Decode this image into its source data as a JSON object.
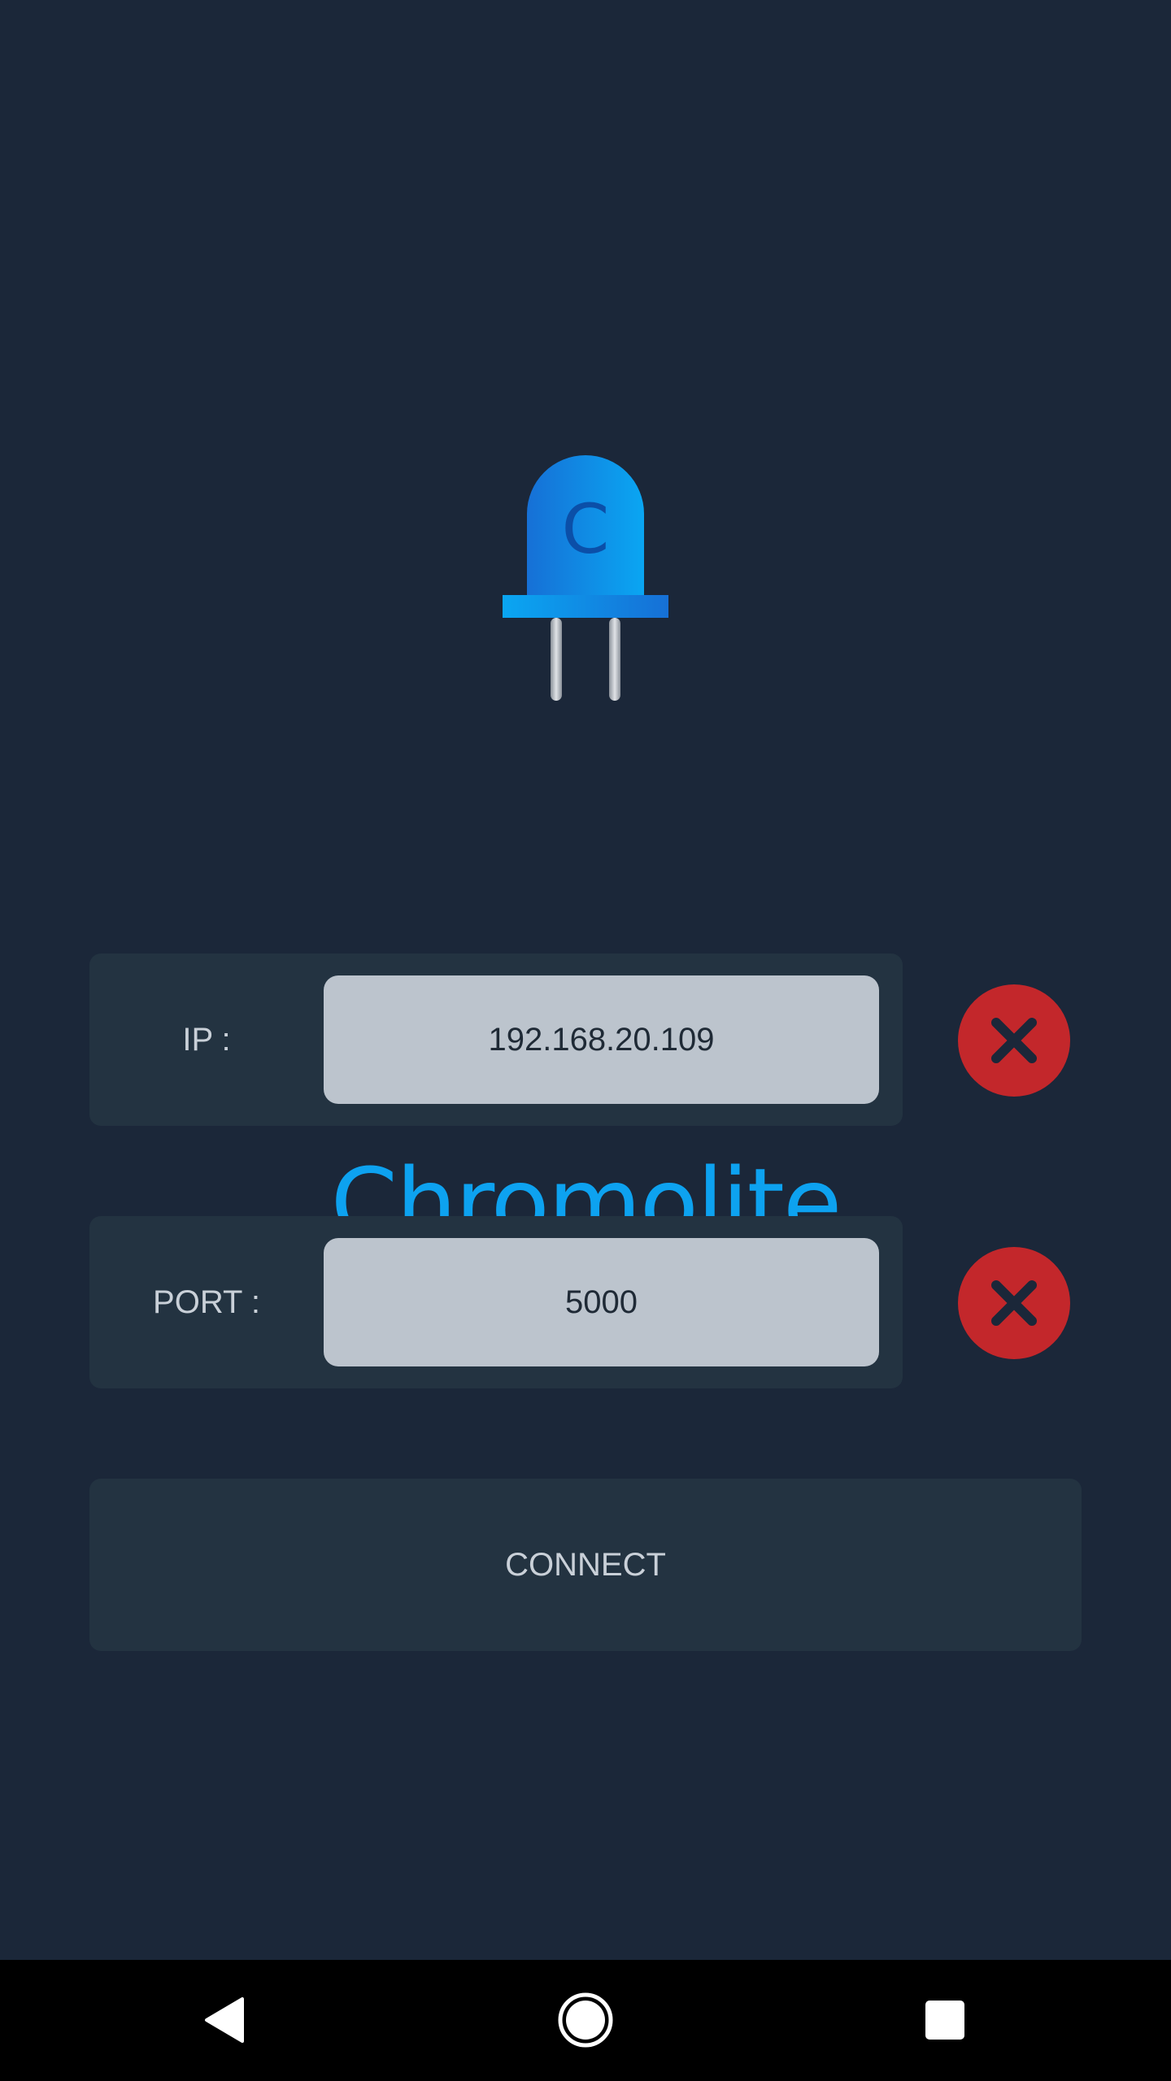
{
  "app": {
    "name": "Chromolite",
    "logo_letter": "C",
    "logo_icon": "led-icon",
    "brand_color": "#0da2f0"
  },
  "form": {
    "ip": {
      "label": "IP :",
      "value": "192.168.20.109",
      "clear_icon": "close-icon"
    },
    "port": {
      "label": "PORT :",
      "value": "5000",
      "clear_icon": "close-icon"
    },
    "connect_label": "CONNECT"
  },
  "colors": {
    "background": "#1b2739",
    "card": "#233341",
    "input": "#bcc4cd",
    "clear_button": "#c3272b"
  },
  "nav": {
    "back_icon": "back-triangle-icon",
    "home_icon": "home-circle-icon",
    "recents_icon": "recents-square-icon"
  }
}
